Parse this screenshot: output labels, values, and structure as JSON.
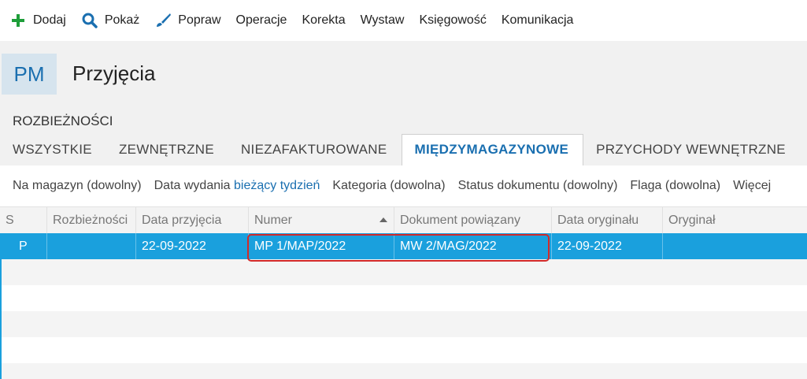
{
  "toolbar": {
    "items": [
      {
        "label": "Dodaj",
        "icon": "plus-icon"
      },
      {
        "label": "Pokaż",
        "icon": "search-icon"
      },
      {
        "label": "Popraw",
        "icon": "brush-icon"
      },
      {
        "label": "Operacje"
      },
      {
        "label": "Korekta"
      },
      {
        "label": "Wystaw"
      },
      {
        "label": "Księgowość"
      },
      {
        "label": "Komunikacja"
      }
    ]
  },
  "header": {
    "badge": "PM",
    "title": "Przyjęcia"
  },
  "section": {
    "label": "ROZBIEŻNOŚCI"
  },
  "tabs": [
    {
      "label": "WSZYSTKIE"
    },
    {
      "label": "ZEWNĘTRZNE"
    },
    {
      "label": "NIEZAFAKTUROWANE"
    },
    {
      "label": "MIĘDZYMAGAZYNOWE",
      "active": true
    },
    {
      "label": "PRZYCHODY WEWNĘTRZNE"
    }
  ],
  "filters": {
    "magazyn": "Na magazyn (dowolny)",
    "data_wydania_label": "Data wydania",
    "data_wydania_value": "bieżący tydzień",
    "kategoria": "Kategoria (dowolna)",
    "status": "Status dokumentu (dowolny)",
    "flaga": "Flaga (dowolna)",
    "wiecej": "Więcej"
  },
  "grid": {
    "columns": [
      "S",
      "Rozbieżności",
      "Data przyjęcia",
      "Numer",
      "Dokument powiązany",
      "Data oryginału",
      "Oryginał"
    ],
    "sorted_column": "Numer",
    "rows": [
      {
        "s": "P",
        "rozbieznosci": "",
        "data_przyjecia": "22-09-2022",
        "numer": "MP 1/MAP/2022",
        "dokument": "MW 2/MAG/2022",
        "data_oryginalu": "22-09-2022",
        "oryginal": ""
      }
    ]
  },
  "colors": {
    "accent": "#1a6fb0",
    "selection": "#1aa0dd",
    "highlight": "#d12a2a",
    "plus_icon": "#1e9e3a"
  }
}
